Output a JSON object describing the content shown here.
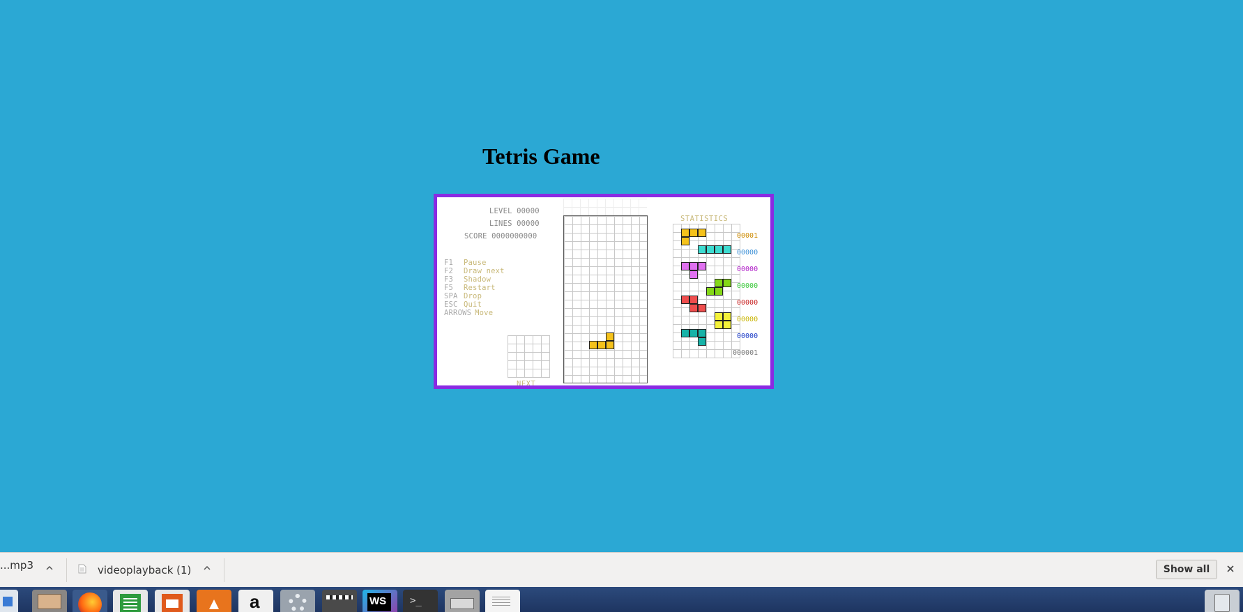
{
  "page": {
    "title": "Tetris Game"
  },
  "game": {
    "level_label": "LEVEL",
    "level_value": "00000",
    "lines_label": "LINES",
    "lines_value": "00000",
    "score_label": "SCORE",
    "score_value": "0000000000",
    "controls": [
      {
        "key": "F1",
        "action": "Pause"
      },
      {
        "key": "F2",
        "action": "Draw next"
      },
      {
        "key": "F3",
        "action": "Shadow"
      },
      {
        "key": "F5",
        "action": "Restart"
      },
      {
        "key": "SPA",
        "action": "Drop"
      },
      {
        "key": "ESC",
        "action": "Quit"
      },
      {
        "key": "ARROWS",
        "action": "Move"
      }
    ],
    "next_label": "NEXT",
    "statistics_label": "STATISTICS",
    "statistics": [
      {
        "piece": "L",
        "color": "#f5c21b",
        "count": "00001",
        "count_color": "#cc8a00"
      },
      {
        "piece": "I",
        "color": "#3ddbd0",
        "count": "00000",
        "count_color": "#3a8fd6"
      },
      {
        "piece": "T",
        "color": "#e070f0",
        "count": "00000",
        "count_color": "#b020c8"
      },
      {
        "piece": "S",
        "color": "#84d817",
        "count": "00000",
        "count_color": "#3cc83c"
      },
      {
        "piece": "Z",
        "color": "#ef4d4d",
        "count": "00000",
        "count_color": "#c82020"
      },
      {
        "piece": "O",
        "color": "#f5f23a",
        "count": "00000",
        "count_color": "#c8b400"
      },
      {
        "piece": "J",
        "color": "#17b3a8",
        "count": "00000",
        "count_color": "#2040c8"
      }
    ],
    "statistics_total": "000001",
    "board": {
      "columns": 10,
      "active_piece_color": "#f5c21b"
    }
  },
  "download_bar": {
    "items": [
      {
        "name": "...mp3"
      },
      {
        "name": "videoplayback (1)"
      }
    ],
    "show_all_label": "Show all"
  },
  "taskbar": {
    "icons": [
      "image-viewer-icon",
      "file-manager-icon",
      "firefox-icon",
      "spreadsheet-icon",
      "presentation-icon",
      "software-center-icon",
      "amazon-icon",
      "settings-icon",
      "video-editor-icon",
      "webstorm-icon",
      "terminal-icon",
      "printer-icon",
      "text-editor-icon",
      "trash-icon"
    ],
    "amazon_letter": "a",
    "webstorm_letters": "WS",
    "terminal_prompt": ">_"
  }
}
